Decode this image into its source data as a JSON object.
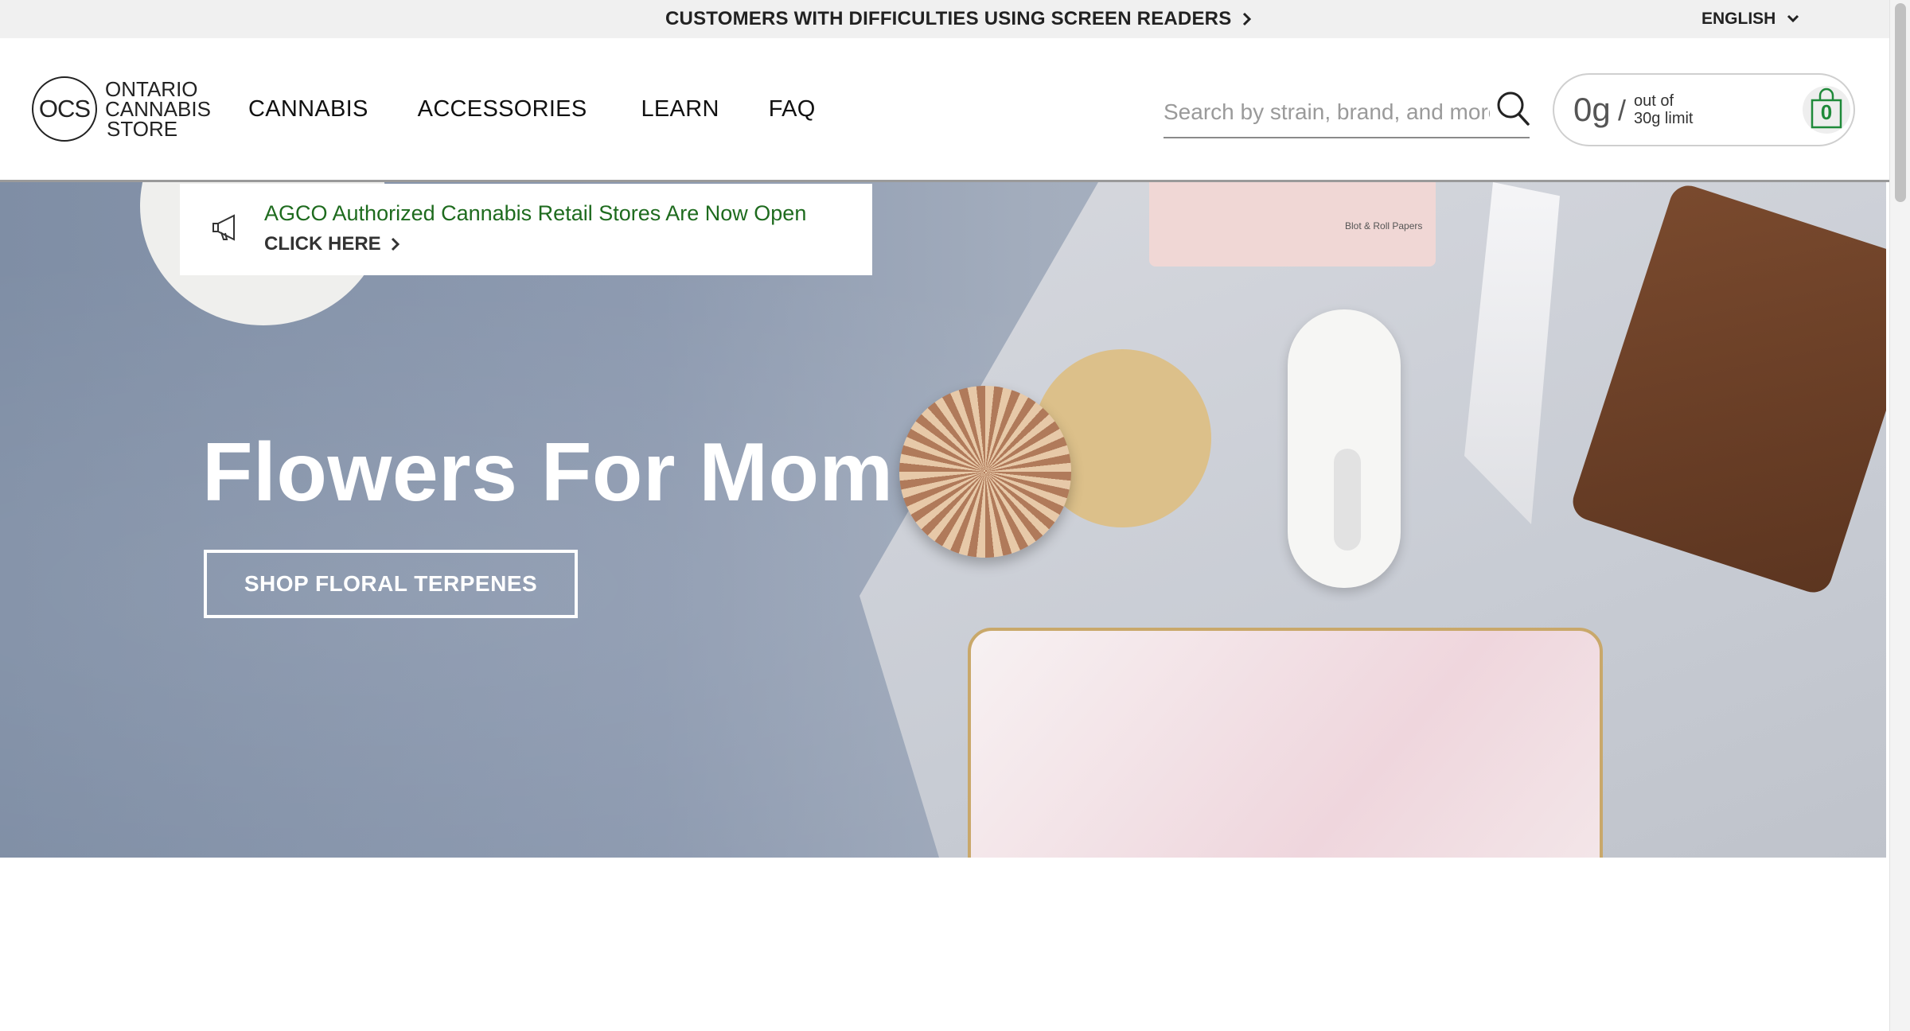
{
  "topbar": {
    "screen_reader_notice": "CUSTOMERS WITH DIFFICULTIES USING SCREEN READERS",
    "language": "ENGLISH"
  },
  "header": {
    "logo": {
      "abbr": "OCS",
      "line1": "ONTARIO",
      "line2": "CANNABIS",
      "line3": "STORE"
    },
    "nav": [
      {
        "label": "CANNABIS"
      },
      {
        "label": "ACCESSORIES"
      },
      {
        "label": "LEARN"
      },
      {
        "label": "FAQ"
      }
    ],
    "search": {
      "placeholder": "Search by strain, brand, and more",
      "value": ""
    },
    "cart": {
      "grams": "0g",
      "slash": "/",
      "limit_line1": "out of",
      "limit_line2": "30g limit",
      "count": "0"
    }
  },
  "notice": {
    "message": "AGCO Authorized Cannabis Retail Stores Are Now Open",
    "cta": "CLICK HERE"
  },
  "hero": {
    "title": "Flowers For Mom",
    "button": "SHOP FLORAL TERPENES",
    "product_label": "Blot & Roll Papers"
  },
  "colors": {
    "notice_text": "#1e6b1e",
    "cart_count": "#1f8a3a",
    "topbar_bg": "#f0f0f0"
  }
}
